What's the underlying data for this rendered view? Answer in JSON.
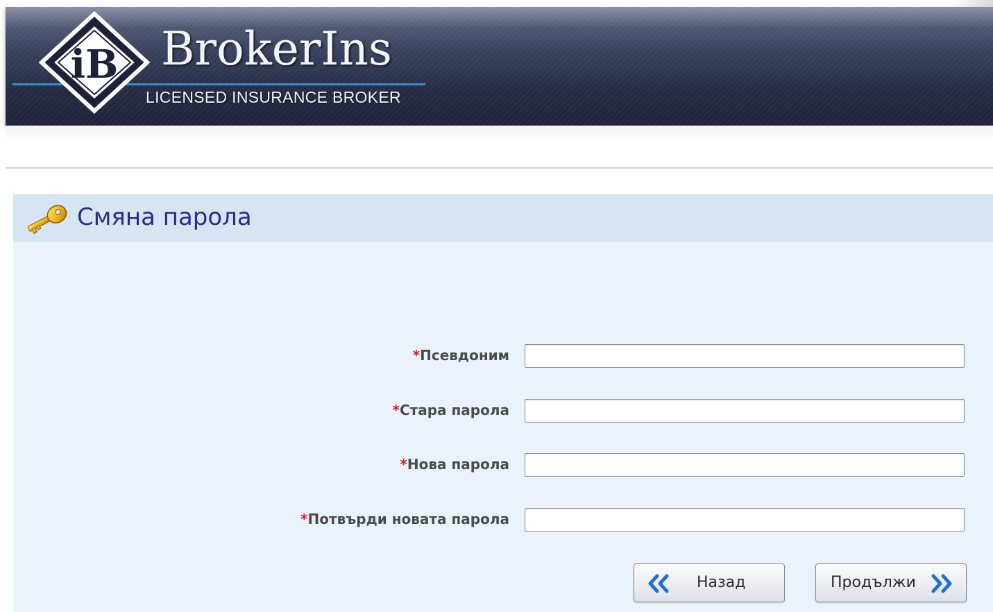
{
  "header": {
    "logo_letters": "iB",
    "brand_name": "BrokerIns",
    "tagline": "LICENSED INSURANCE BROKER"
  },
  "panel": {
    "title": "Смяна парола",
    "icon": "key-icon"
  },
  "form": {
    "required_marker": "*",
    "fields": [
      {
        "label": "Псевдоним",
        "value": "",
        "type": "text"
      },
      {
        "label": "Стара парола",
        "value": "",
        "type": "password"
      },
      {
        "label": "Нова парола",
        "value": "",
        "type": "password"
      },
      {
        "label": "Потвърди новата парола",
        "value": "",
        "type": "password"
      }
    ]
  },
  "buttons": {
    "back_label": "Назад",
    "back_icon": "double-chevron-left-icon",
    "next_label": "Продължи",
    "next_icon": "double-chevron-right-icon"
  },
  "colors": {
    "banner_dark": "#262c45",
    "title_text": "#2c2a8c",
    "required_marker": "#d02020",
    "panel_bg": "#eaf3fb",
    "panel_header_bg": "#d5e5f1",
    "chevron_blue": "#1f6fd6"
  }
}
